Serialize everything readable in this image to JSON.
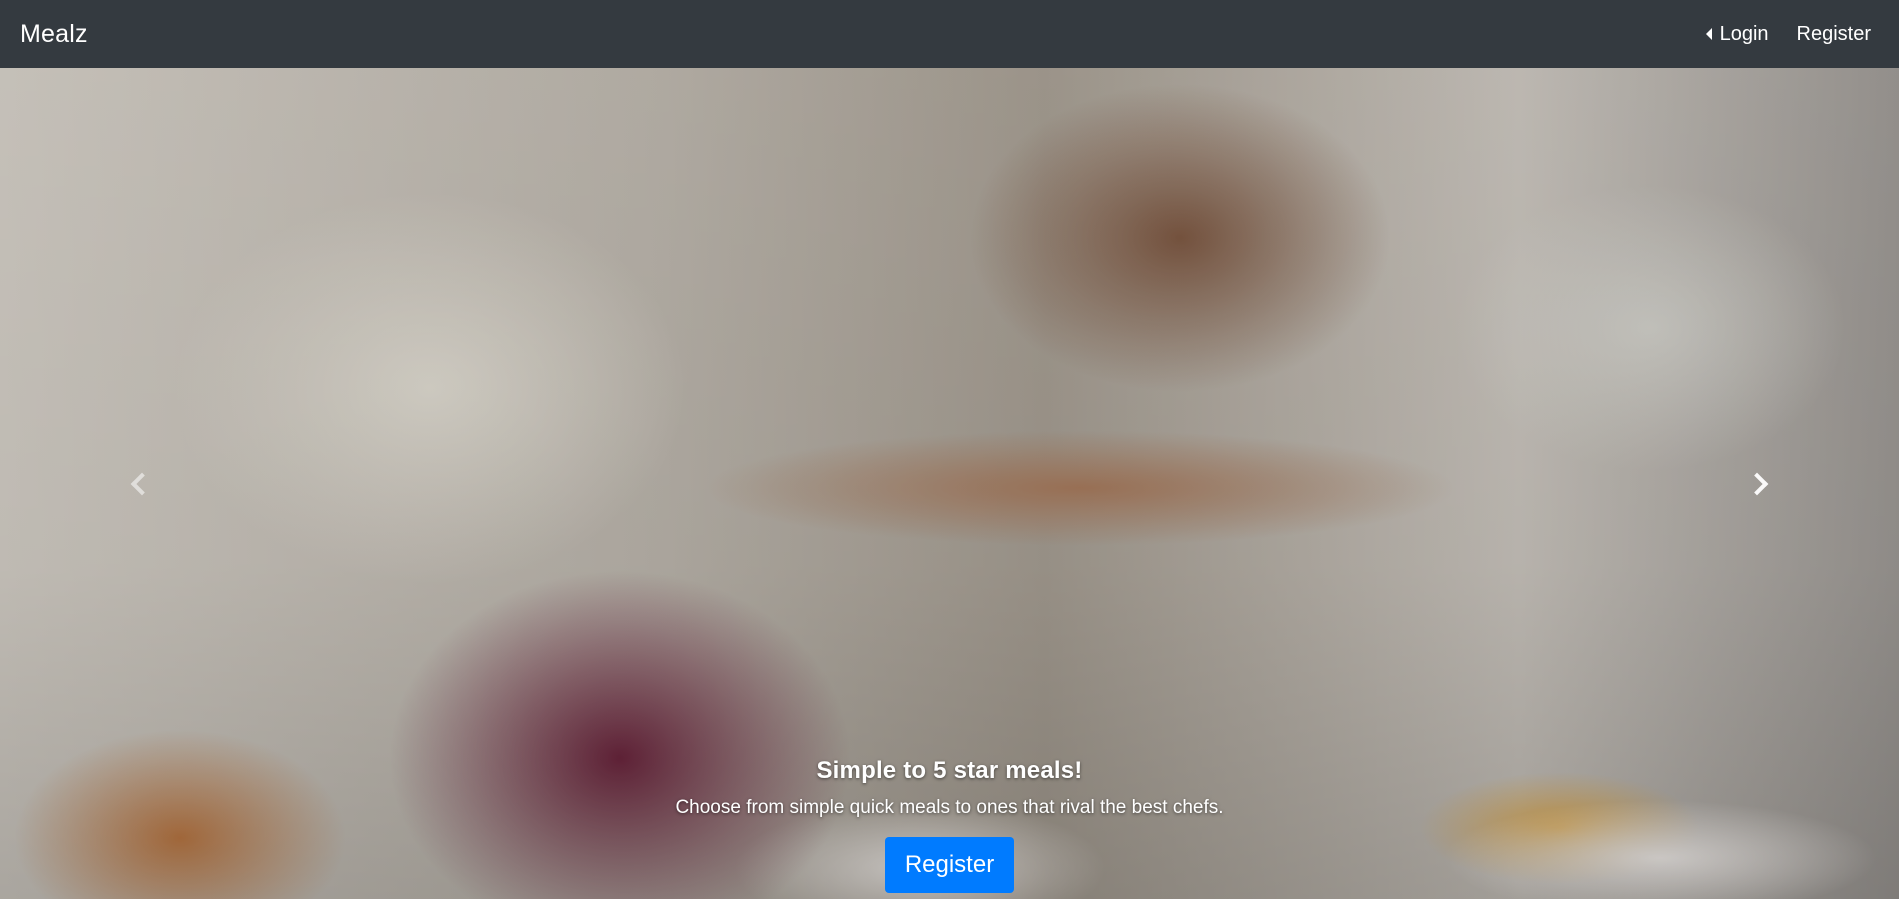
{
  "navbar": {
    "brand": "Mealz",
    "login_label": "Login",
    "register_label": "Register"
  },
  "hero": {
    "title": "Simple to 5 star meals!",
    "subtitle": "Choose from simple quick meals to ones that rival the best chefs.",
    "cta_label": "Register",
    "prev_icon": "chevron-left-icon",
    "next_icon": "chevron-right-icon"
  },
  "colors": {
    "navbar_bg": "#343a40",
    "primary": "#007bff",
    "text": "#ffffff"
  }
}
